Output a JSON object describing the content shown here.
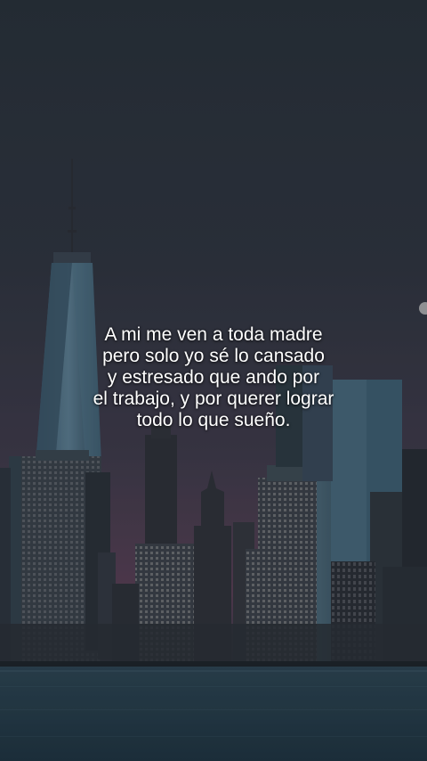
{
  "caption": {
    "lines": [
      "A mi me ven a toda madre",
      "pero solo yo sé lo cansado",
      "y estresado que ando por",
      "el trabajo, y por querer lograr",
      "todo lo que sueño."
    ]
  },
  "colors": {
    "sky_top": "#2b323b",
    "sky_horizon": "#5a3f55",
    "water": "#223a48",
    "text": "#ffffff"
  }
}
